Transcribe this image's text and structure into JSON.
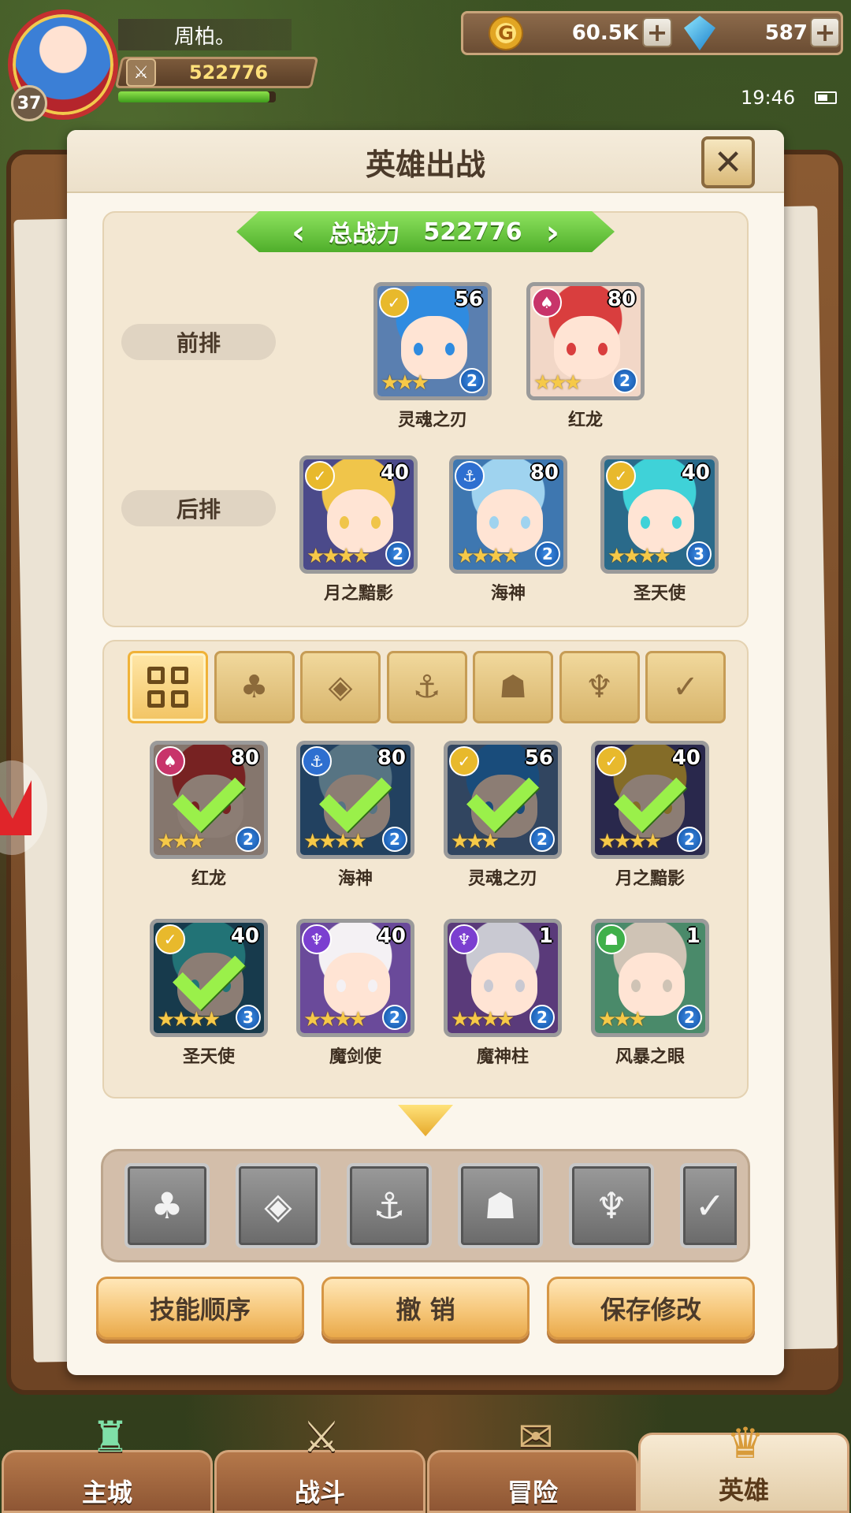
{
  "player": {
    "name": "周柏。",
    "level": "37",
    "power": "522776",
    "exp_fraction": 0.96
  },
  "resources": {
    "gold": "60.5K",
    "gems": "587",
    "gold_glyph": "G"
  },
  "status": {
    "time": "19:46"
  },
  "dialog": {
    "title": "英雄出战",
    "close_glyph": "✕",
    "total_power_label": "总战力",
    "total_power_value": "522776",
    "front_row_label": "前排",
    "back_row_label": "后排"
  },
  "front_row": [
    {
      "name": "灵魂之刃",
      "level": "56",
      "awaken": "2",
      "faction_glyph": "✓",
      "faction_color": "#e8b92c",
      "hair": "#2f8be0",
      "bg": "#5a7fb0",
      "stars": "★★★"
    },
    {
      "name": "红龙",
      "level": "80",
      "awaken": "2",
      "faction_glyph": "♠",
      "faction_color": "#c8346a",
      "hair": "#d93e3e",
      "bg": "#f2d7c7",
      "stars": "★★★"
    }
  ],
  "back_row": [
    {
      "name": "月之黯影",
      "level": "40",
      "awaken": "2",
      "faction_glyph": "✓",
      "faction_color": "#e8b92c",
      "hair": "#f0c54a",
      "bg": "#4b4a8a",
      "stars": "★★★★"
    },
    {
      "name": "海神",
      "level": "80",
      "awaken": "2",
      "faction_glyph": "⚓",
      "faction_color": "#2e6fd0",
      "hair": "#9fd3ef",
      "bg": "#3e77b0",
      "stars": "★★★★"
    },
    {
      "name": "圣天使",
      "level": "40",
      "awaken": "3",
      "faction_glyph": "✓",
      "faction_color": "#e8b92c",
      "hair": "#3fd2d8",
      "bg": "#2a6a8a",
      "stars": "★★★★"
    }
  ],
  "filter_tabs": [
    {
      "name": "all",
      "glyph": ""
    },
    {
      "name": "plant",
      "glyph": "♣"
    },
    {
      "name": "gem",
      "glyph": "◈"
    },
    {
      "name": "anchor",
      "glyph": "⚓"
    },
    {
      "name": "beast",
      "glyph": "☗"
    },
    {
      "name": "demon",
      "glyph": "♆"
    },
    {
      "name": "wing",
      "glyph": "✓"
    }
  ],
  "hero_list": [
    {
      "name": "红龙",
      "level": "80",
      "awaken": "2",
      "faction_glyph": "♠",
      "faction_color": "#c8346a",
      "hair": "#d93e3e",
      "bg": "#f2d7c7",
      "stars": "★★★",
      "selected": true
    },
    {
      "name": "海神",
      "level": "80",
      "awaken": "2",
      "faction_glyph": "⚓",
      "faction_color": "#2e6fd0",
      "hair": "#9fd3ef",
      "bg": "#3e77b0",
      "stars": "★★★★",
      "selected": true
    },
    {
      "name": "灵魂之刃",
      "level": "56",
      "awaken": "2",
      "faction_glyph": "✓",
      "faction_color": "#e8b92c",
      "hair": "#2f8be0",
      "bg": "#5a7fb0",
      "stars": "★★★",
      "selected": true
    },
    {
      "name": "月之黯影",
      "level": "40",
      "awaken": "2",
      "faction_glyph": "✓",
      "faction_color": "#e8b92c",
      "hair": "#f0c54a",
      "bg": "#4b4a8a",
      "stars": "★★★★",
      "selected": true
    },
    {
      "name": "圣天使",
      "level": "40",
      "awaken": "3",
      "faction_glyph": "✓",
      "faction_color": "#e8b92c",
      "hair": "#3fd2d8",
      "bg": "#2a6a8a",
      "stars": "★★★★",
      "selected": true
    },
    {
      "name": "魔剑使",
      "level": "40",
      "awaken": "2",
      "faction_glyph": "♆",
      "faction_color": "#7b3fd0",
      "hair": "#f4f1f4",
      "bg": "#6a4a9a",
      "stars": "★★★★",
      "selected": false
    },
    {
      "name": "魔神柱",
      "level": "1",
      "awaken": "2",
      "faction_glyph": "♆",
      "faction_color": "#7b3fd0",
      "hair": "#c9c9d2",
      "bg": "#5a3a7a",
      "stars": "★★★★",
      "selected": false
    },
    {
      "name": "风暴之眼",
      "level": "1",
      "awaken": "2",
      "faction_glyph": "☗",
      "faction_color": "#3fb04a",
      "hair": "#cfc3b5",
      "bg": "#4a8a6a",
      "stars": "★★★",
      "selected": false
    }
  ],
  "faction_slots": [
    {
      "name": "plant",
      "glyph": "♣"
    },
    {
      "name": "gem",
      "glyph": "◈"
    },
    {
      "name": "anchor",
      "glyph": "⚓"
    },
    {
      "name": "beast",
      "glyph": "☗"
    },
    {
      "name": "demon",
      "glyph": "♆"
    },
    {
      "name": "wing",
      "glyph": "✓"
    }
  ],
  "actions": {
    "skill_order": "技能顺序",
    "undo": "撤 销",
    "save": "保存修改"
  },
  "nav": {
    "city": "主城",
    "battle": "战斗",
    "adventure": "冒险",
    "heroes": "英雄"
  }
}
